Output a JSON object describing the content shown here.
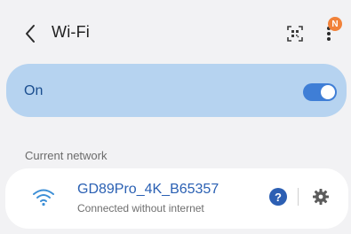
{
  "header": {
    "title": "Wi-Fi",
    "notification_badge": "N",
    "back_icon": "chevron-left-icon",
    "qr_icon": "qr-code-scan-icon",
    "more_icon": "more-vert-icon"
  },
  "master_switch": {
    "label": "On",
    "state": true,
    "accent_color": "#3f7ed6",
    "card_color": "#b6d3f0"
  },
  "current_network": {
    "section_title": "Current network",
    "ssid": "GD89Pro_4K_B65357",
    "status": "Connected without internet",
    "wifi_icon": "wifi-icon",
    "help_icon": "question-mark-icon",
    "help_label": "?",
    "settings_icon": "gear-icon"
  }
}
